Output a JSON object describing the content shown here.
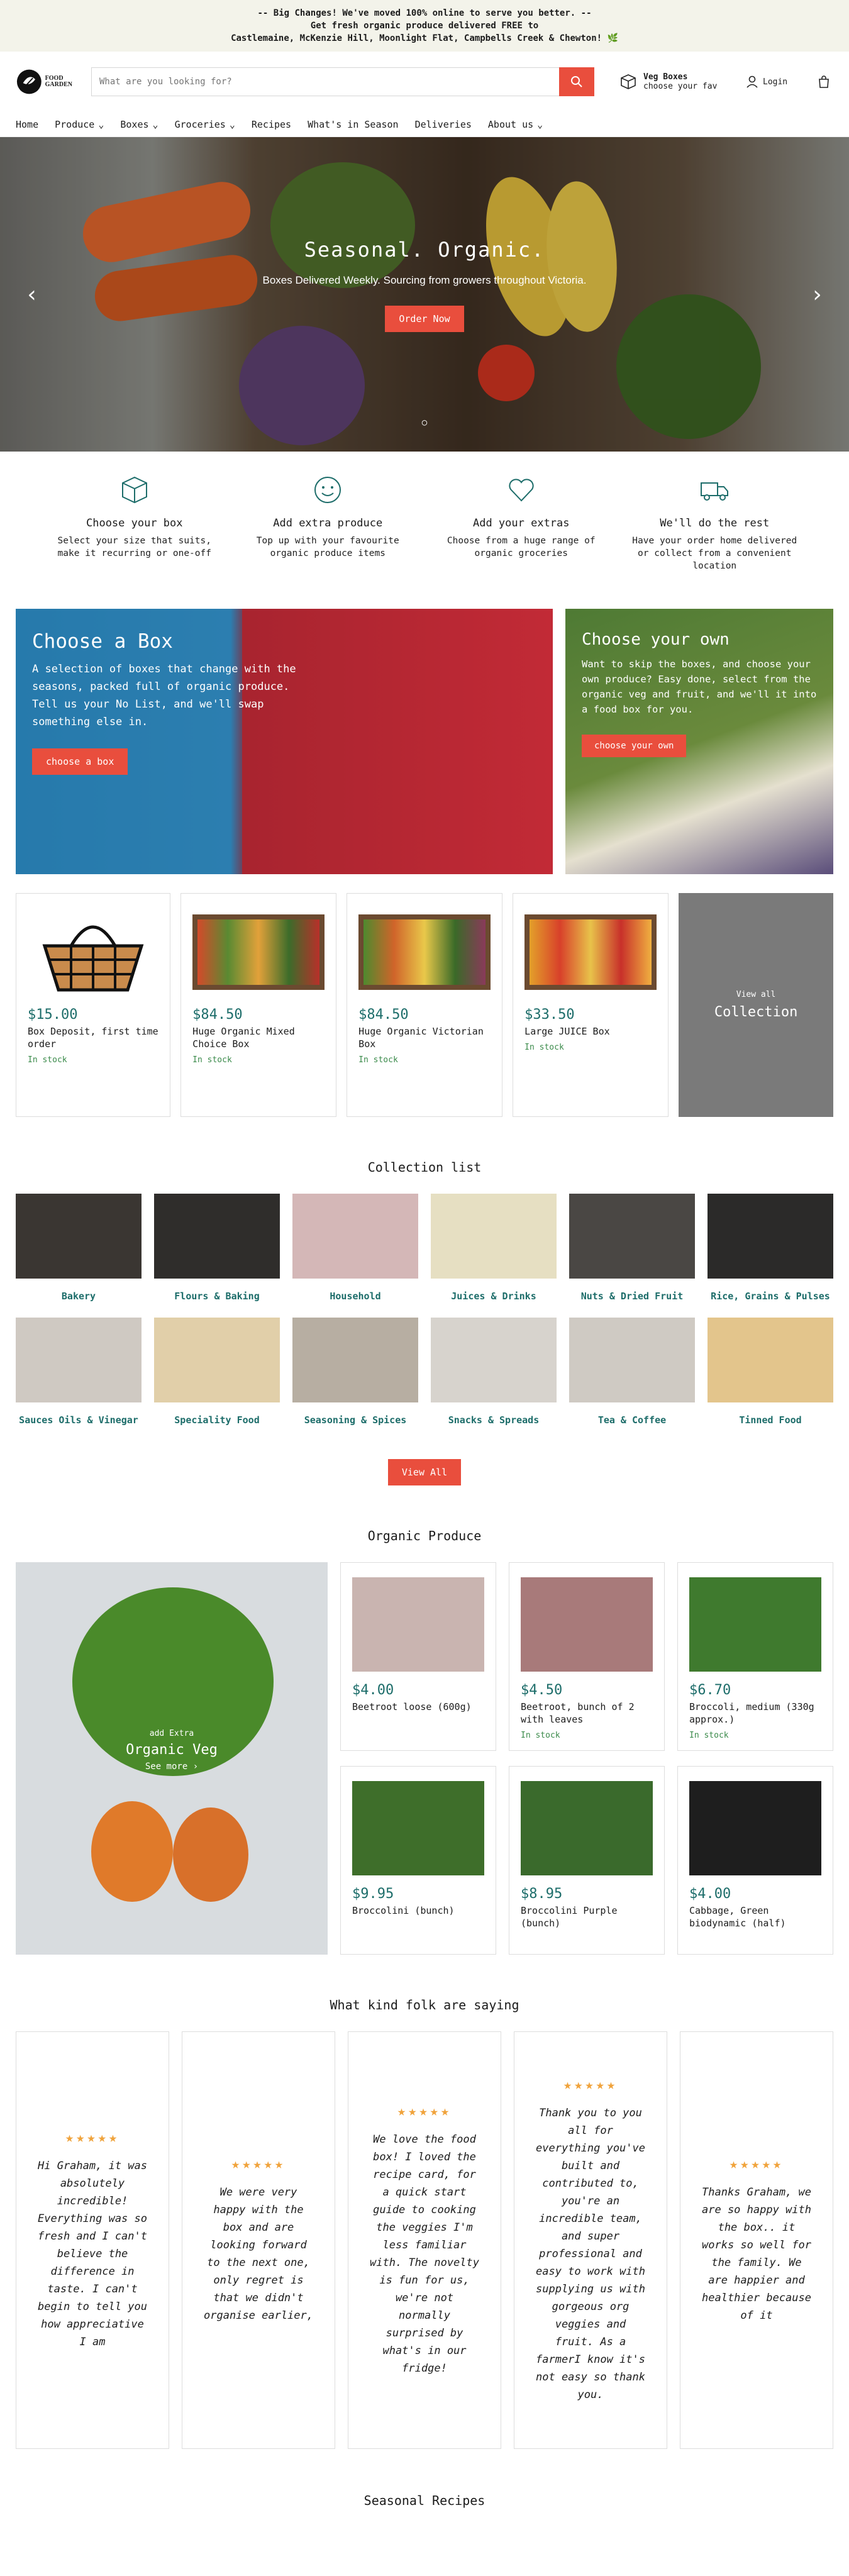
{
  "announcement": {
    "line1": "-- Big Changes! We've moved 100% online to serve you better. --",
    "line2": "Get fresh organic produce delivered FREE to",
    "line3": "Castlemaine, McKenzie Hill, Moonlight Flat, Campbells Creek & Chewton! 🌿"
  },
  "header": {
    "logo_line1": "FOOD",
    "logo_line2": "GARDEN",
    "search_placeholder": "What are you looking for?",
    "veg_boxes_title": "Veg Boxes",
    "veg_boxes_sub": "choose your fav",
    "login_label": "Login"
  },
  "nav": {
    "items": [
      {
        "label": "Home"
      },
      {
        "label": "Produce"
      },
      {
        "label": "Boxes"
      },
      {
        "label": "Groceries"
      },
      {
        "label": "Recipes"
      },
      {
        "label": "What's in Season"
      },
      {
        "label": "Deliveries"
      },
      {
        "label": "About us"
      }
    ]
  },
  "hero": {
    "title": "Seasonal. Organic.",
    "subtitle": "Boxes Delivered Weekly. Sourcing from growers throughout Victoria.",
    "button": "Order Now",
    "prev": "‹",
    "next": "›",
    "dots": "○"
  },
  "features": [
    {
      "title": "Choose your box",
      "text": "Select your size that suits, make it recurring or one-off",
      "icon": "box-icon"
    },
    {
      "title": "Add extra produce",
      "text": "Top up with your favourite organic produce items",
      "icon": "smile-icon"
    },
    {
      "title": "Add your extras",
      "text": "Choose from a huge range of organic groceries",
      "icon": "heart-icon"
    },
    {
      "title": "We'll do the rest",
      "text": "Have your order home delivered or collect from a convenient location",
      "icon": "truck-icon"
    }
  ],
  "promo": {
    "box_title": "Choose a Box",
    "box_text": "A selection of boxes that change with the seasons, packed full of organic produce. Tell us your No List, and we'll swap something else in.",
    "box_button": "choose a box",
    "own_title": "Choose your own",
    "own_text": "Want to skip the boxes, and choose your own produce? Easy done, select from the organic veg and fruit, and we'll it into a food box for you.",
    "own_button": "choose your own"
  },
  "products": [
    {
      "price": "$15.00",
      "name": "Box Deposit, first time order",
      "stock": "In stock"
    },
    {
      "price": "$84.50",
      "name": "Huge Organic Mixed Choice Box",
      "stock": "In stock"
    },
    {
      "price": "$84.50",
      "name": "Huge Organic Victorian Box",
      "stock": "In stock"
    },
    {
      "price": "$33.50",
      "name": "Large JUICE Box",
      "stock": "In stock"
    }
  ],
  "collection_card": {
    "small": "View all",
    "big": "Collection"
  },
  "collection_list": {
    "title": "Collection list",
    "items": [
      {
        "label": "Bakery",
        "color": "#3a3632"
      },
      {
        "label": "Flours & Baking",
        "color": "#2f2d2b"
      },
      {
        "label": "Household",
        "color": "#d4b7b7"
      },
      {
        "label": "Juices & Drinks",
        "color": "#e6dfc2"
      },
      {
        "label": "Nuts & Dried Fruit",
        "color": "#4a4744"
      },
      {
        "label": "Rice, Grains & Pulses",
        "color": "#2b2a29"
      },
      {
        "label": "Sauces Oils & Vinegar",
        "color": "#cfc9c2"
      },
      {
        "label": "Speciality Food",
        "color": "#e1cfa9"
      },
      {
        "label": "Seasoning & Spices",
        "color": "#b7aea2"
      },
      {
        "label": "Snacks & Spreads",
        "color": "#d7d3cd"
      },
      {
        "label": "Tea & Coffee",
        "color": "#cfcac3"
      },
      {
        "label": "Tinned Food",
        "color": "#e3c58c"
      }
    ],
    "view_all": "View All"
  },
  "organic_produce": {
    "title": "Organic Produce",
    "feature_small": "add Extra",
    "feature_big": "Organic Veg",
    "feature_link": "See more ›",
    "items": [
      {
        "price": "$4.00",
        "name": "Beetroot loose (600g)",
        "stock": ""
      },
      {
        "price": "$4.50",
        "name": "Beetroot, bunch of 2 with leaves",
        "stock": "In stock"
      },
      {
        "price": "$6.70",
        "name": "Broccoli, medium (330g approx.)",
        "stock": "In stock"
      },
      {
        "price": "$9.95",
        "name": "Broccolini (bunch)",
        "stock": ""
      },
      {
        "price": "$8.95",
        "name": "Broccolini Purple (bunch)",
        "stock": ""
      },
      {
        "price": "$4.00",
        "name": "Cabbage, Green biodynamic (half)",
        "stock": ""
      }
    ]
  },
  "reviews": {
    "title": "What kind folk are saying",
    "stars": "★★★★★",
    "items": [
      {
        "text": "Hi Graham, it was absolutely incredible! Everything was so fresh and I can't believe the difference in taste. I can't begin to tell you how appreciative I am"
      },
      {
        "text": "We were very happy with the box and are looking forward to the next one, only regret is that we didn't organise earlier,"
      },
      {
        "text": "We love the food box! I loved the recipe card, for a quick start guide to cooking the veggies I'm less familiar with. The novelty is fun for us, we're not normally surprised by what's in our fridge!"
      },
      {
        "text": "Thank you to you all for everything you've built and contributed to, you're an incredible team, and super professional and easy to work with supplying us with gorgeous org veggies and fruit. As a farmerI know it's not easy so thank you."
      },
      {
        "text": "Thanks Graham, we are so happy with the box.. it works so well for the family. We are happier and healthier because of it"
      }
    ]
  },
  "footer_title": "Seasonal Recipes"
}
